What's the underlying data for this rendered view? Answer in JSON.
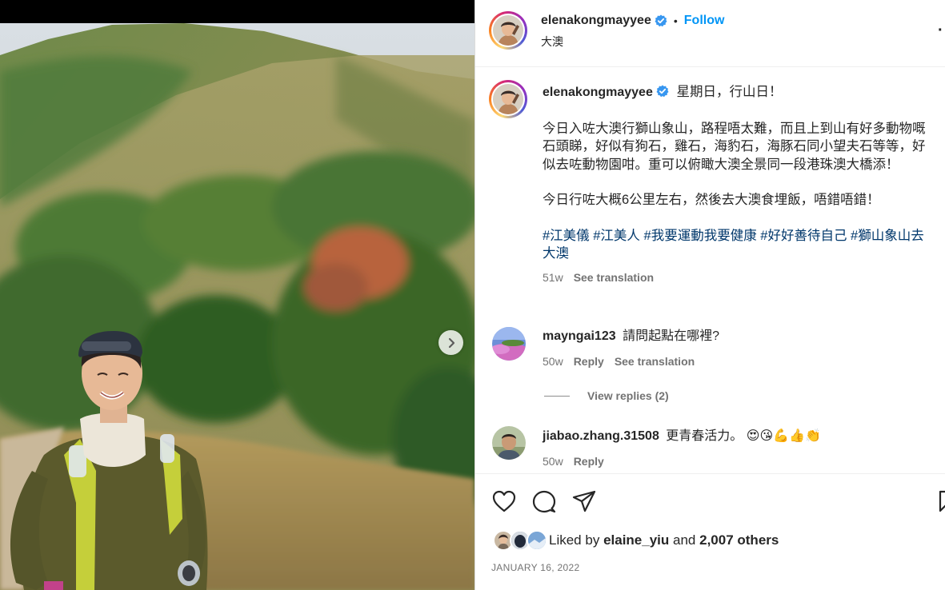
{
  "post": {
    "username": "elenakongmayyee",
    "follow_label": "Follow",
    "separator": "•",
    "location": "大澳",
    "more_label": "·"
  },
  "caption": {
    "username": "elenakongmayyee",
    "first_line": "星期日，行山日！",
    "para1": "今日入咗大澳行獅山象山，路程唔太難，而且上到山有好多動物嘅石頭睇，好似有狗石，雞石，海豹石，海豚石同小望夫石等等，好似去咗動物園咁。重可以俯瞰大澳全景同一段港珠澳大橋添！",
    "para2": "今日行咗大概6公里左右，然後去大澳食埋飯，唔錯唔錯！",
    "hashtags": "#江美儀 #江美人 #我要運動我要健康 #好好善待自己 #獅山象山去大澳",
    "time": "51w",
    "see_translation": "See translation"
  },
  "comments": [
    {
      "username": "mayngai123",
      "text": "請問起點在哪裡?",
      "time": "50w",
      "reply": "Reply",
      "see_translation": "See translation",
      "view_replies": "View replies (2)"
    },
    {
      "username": "jiabao.zhang.31508",
      "text": "更青春活力。",
      "emojis": [
        "😍",
        "😘",
        "💪",
        "👍",
        "👏"
      ],
      "time": "50w",
      "reply": "Reply"
    }
  ],
  "likes": {
    "prefix": "Liked by",
    "user": "elaine_yiu",
    "and": "and",
    "others": "2,007 others"
  },
  "date": "JANUARY 16, 2022",
  "colors": {
    "follow_blue": "#0095f6",
    "hashtag": "#00376b",
    "muted": "#737373",
    "verified": "#3897f0"
  }
}
